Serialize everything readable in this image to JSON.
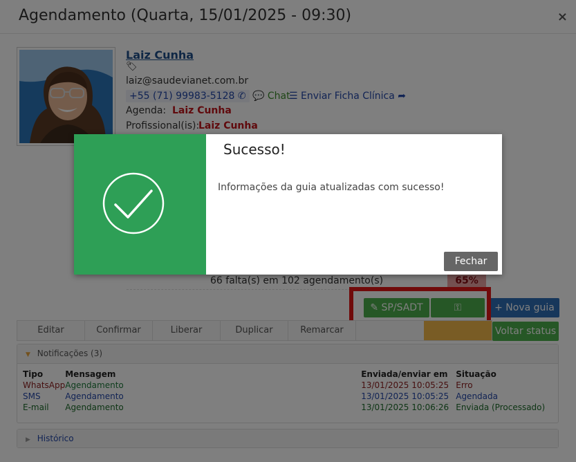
{
  "modal": {
    "title": "Agendamento (Quarta, 15/01/2025 - 09:30)",
    "close_label": "×"
  },
  "patient": {
    "name": "Laiz Cunha",
    "email": "laiz@saudevianet.com.br",
    "phone": "+55 (71) 99983-5128",
    "chat_label": "Chat",
    "ficha_label": "Enviar Ficha Clínica",
    "agenda_label": "Agenda:",
    "agenda_value": "Laiz Cunha",
    "profissional_label": "Profissional(is):",
    "profissional_value": "Laiz Cunha"
  },
  "faltas": {
    "text": "66 falta(s) em 102 agendamento(s)",
    "percent": "65%"
  },
  "buttons": {
    "sp_sadt": "SP/SADT",
    "nova_guia": "Nova guia",
    "voltar_status": "Voltar status"
  },
  "actions": [
    "Editar",
    "Confirmar",
    "Liberar",
    "Duplicar",
    "Remarcar"
  ],
  "notificacoes": {
    "header": "Notificações (3)",
    "columns": [
      "Tipo",
      "Mensagem",
      "Enviada/enviar em",
      "Situação"
    ],
    "rows": [
      {
        "tipo": "WhatsApp",
        "mensagem": "Agendamento",
        "data": "13/01/2025 10:05:25",
        "situacao": "Erro"
      },
      {
        "tipo": "SMS",
        "mensagem": "Agendamento",
        "data": "13/01/2025 10:05:25",
        "situacao": "Agendada"
      },
      {
        "tipo": "E-mail",
        "mensagem": "Agendamento",
        "data": "13/01/2025 10:06:26",
        "situacao": "Enviada (Processado)"
      }
    ]
  },
  "historico": {
    "header": "Histórico"
  },
  "alert": {
    "title": "Sucesso!",
    "message": "Informações da guia atualizadas com sucesso!",
    "close_button": "Fechar"
  },
  "colors": {
    "success_green": "#2e9f56",
    "danger_red": "#c0141a",
    "link_blue": "#2347a8",
    "highlight_red": "#e01616"
  }
}
